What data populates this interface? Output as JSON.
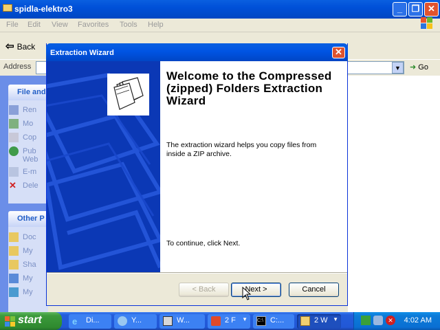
{
  "explorer": {
    "title": "spidla-elektro3",
    "menu": [
      "File",
      "Edit",
      "View",
      "Favorites",
      "Tools",
      "Help"
    ],
    "back_label": "Back",
    "address_label": "Address",
    "go_label": "Go",
    "panels": {
      "file_tasks_header": "File and",
      "file_tasks": [
        "Ren",
        "Mo",
        "Cop",
        "Pub",
        "E-m",
        "Dele"
      ],
      "file_tasks_extra": "Web",
      "other_places_header": "Other P",
      "other_places": [
        "Doc",
        "My",
        "Sha",
        "My",
        "My"
      ]
    }
  },
  "wizard": {
    "title": "Extraction Wizard",
    "heading": "Welcome to the Compressed (zipped) Folders Extraction Wizard",
    "description": "The extraction wizard helps you copy files from inside a ZIP archive.",
    "continue_text": "To continue, click Next.",
    "back_label": "< Back",
    "next_label": "Next >",
    "cancel_label": "Cancel"
  },
  "taskbar": {
    "start_label": "start",
    "items": [
      {
        "label": "Di...",
        "icon": "ie-icon"
      },
      {
        "label": "Y...",
        "icon": "messenger-icon"
      },
      {
        "label": "W...",
        "icon": "window-icon"
      },
      {
        "label": "2 F",
        "icon": "app-icon"
      },
      {
        "label": "C:...",
        "icon": "cmd-icon"
      },
      {
        "label": "2 W",
        "icon": "folder-icon"
      }
    ],
    "clock": "4:02 AM"
  },
  "colors": {
    "title_blue": "#0054e3",
    "taskbar_blue": "#245edb",
    "start_green": "#3c9a3c",
    "wizard_side": "#0b38b5",
    "close_red": "#e0532e"
  }
}
